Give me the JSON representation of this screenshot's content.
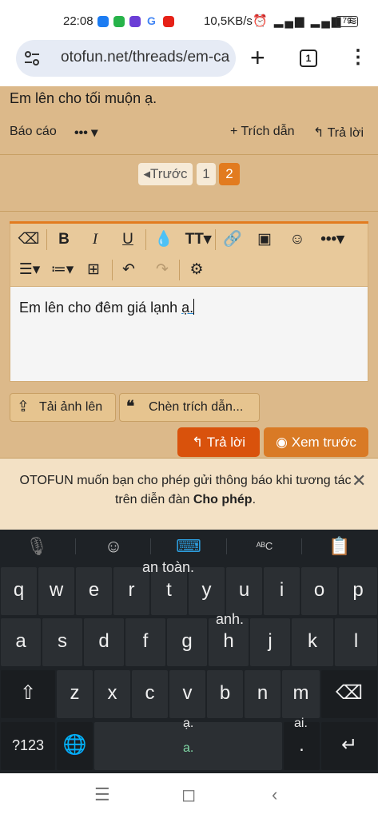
{
  "status_bar": {
    "time": "22:08",
    "net_speed": "10,5KB/s",
    "battery": "79",
    "signal_icons": "⏰ ▂▄▆ ▂▄▆ ≋"
  },
  "browser": {
    "url": "otofun.net/threads/em-ca",
    "tab_count": "1",
    "new_tab_label": "+",
    "menu_label": "⋮"
  },
  "post": {
    "text": "Em lên cho tối muộn ạ.",
    "actions": {
      "report": "Báo cáo",
      "more": "•••",
      "quote": "+ Trích dẫn",
      "reply": "Trả lời"
    }
  },
  "pagination": {
    "prev": "Trước",
    "pages": [
      "1",
      "2"
    ],
    "current": "2"
  },
  "editor": {
    "content_plain": "Em lên cho đêm giá lạnh ",
    "content_underlined": "ạ.",
    "upload_button": "Tải ảnh lên",
    "insert_quote_button": "Chèn trích dẫn...",
    "reply_button": "Trả lời",
    "preview_button": "Xem trước"
  },
  "notification": {
    "text": "OTOFUN muốn bạn cho phép gửi thông báo khi tương tác trên diễn đàn ",
    "allow_link": "Cho phép",
    "suffix": ".",
    "close": "✕"
  },
  "keyboard": {
    "suggestions": {
      "top_suggestion": "an toàn.",
      "mid_suggestion": "anh.",
      "v_hint": "ạ.",
      "m_hint": "ai.",
      "dot_hint": "a."
    },
    "row1": [
      "q",
      "w",
      "e",
      "r",
      "t",
      "y",
      "u",
      "i",
      "o",
      "p"
    ],
    "row2": [
      "a",
      "s",
      "d",
      "f",
      "g",
      "h",
      "j",
      "k",
      "l"
    ],
    "row3": [
      "z",
      "x",
      "c",
      "v",
      "b",
      "n",
      "m"
    ],
    "numeric_key": "?123",
    "period_key": "."
  },
  "colors": {
    "page_bg": "#dcb98a",
    "accent": "#e27b1f",
    "reply_btn": "#d9520c",
    "preview_btn": "#d97a25",
    "keyboard_bg": "#1e2226"
  }
}
